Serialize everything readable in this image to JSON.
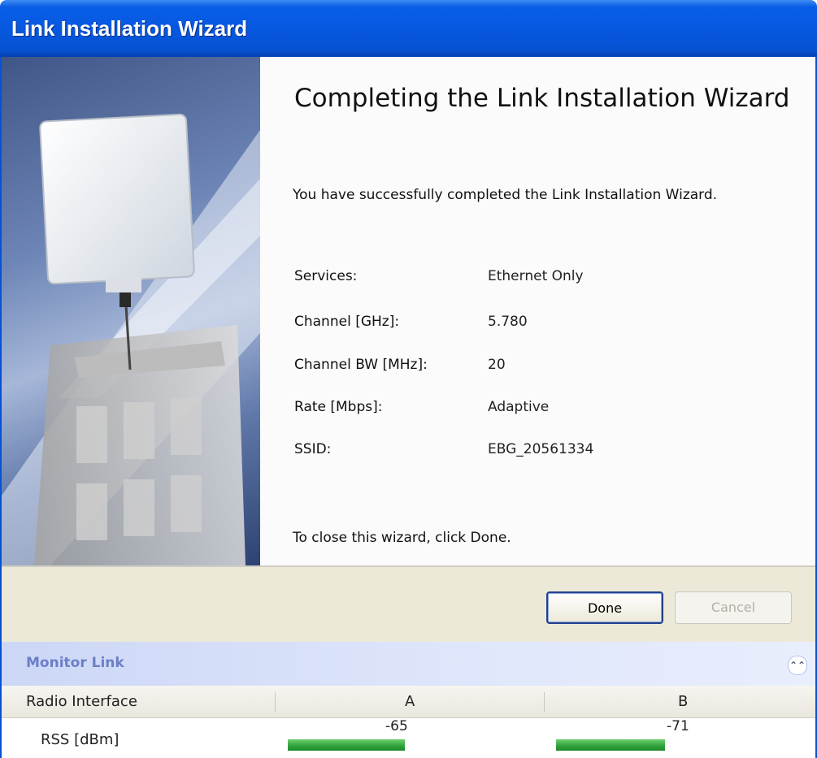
{
  "window": {
    "title": "Link Installation Wizard"
  },
  "page": {
    "heading": "Completing the Link Installation Wizard",
    "success_message": "You have successfully completed the Link Installation  Wizard.",
    "summary": [
      {
        "label": "Services:",
        "value": "Ethernet Only"
      },
      {
        "label": "Channel [GHz]:",
        "value": "5.780"
      },
      {
        "label": "Channel BW [MHz]:",
        "value": "20"
      },
      {
        "label": "Rate [Mbps]:",
        "value": "Adaptive"
      },
      {
        "label": "SSID:",
        "value": "EBG_20561334"
      }
    ],
    "closing_text": "To close this wizard, click Done."
  },
  "buttons": {
    "done": "Done",
    "cancel": "Cancel"
  },
  "monitor": {
    "title": "Monitor Link",
    "collapse_icon": "double-chevron-up-icon",
    "table": {
      "headers": [
        "Radio Interface",
        "A",
        "B"
      ],
      "rows": [
        {
          "label": "RSS [dBm]",
          "a": "-65",
          "b": "-71",
          "a_bar_fraction": 0.45,
          "b_bar_fraction": 0.42
        }
      ]
    }
  },
  "colors": {
    "titlebar": "#0652d2",
    "done_border": "#26418b",
    "signal_bar": "#2ea03a",
    "monitor_title": "#6b7fc8"
  }
}
